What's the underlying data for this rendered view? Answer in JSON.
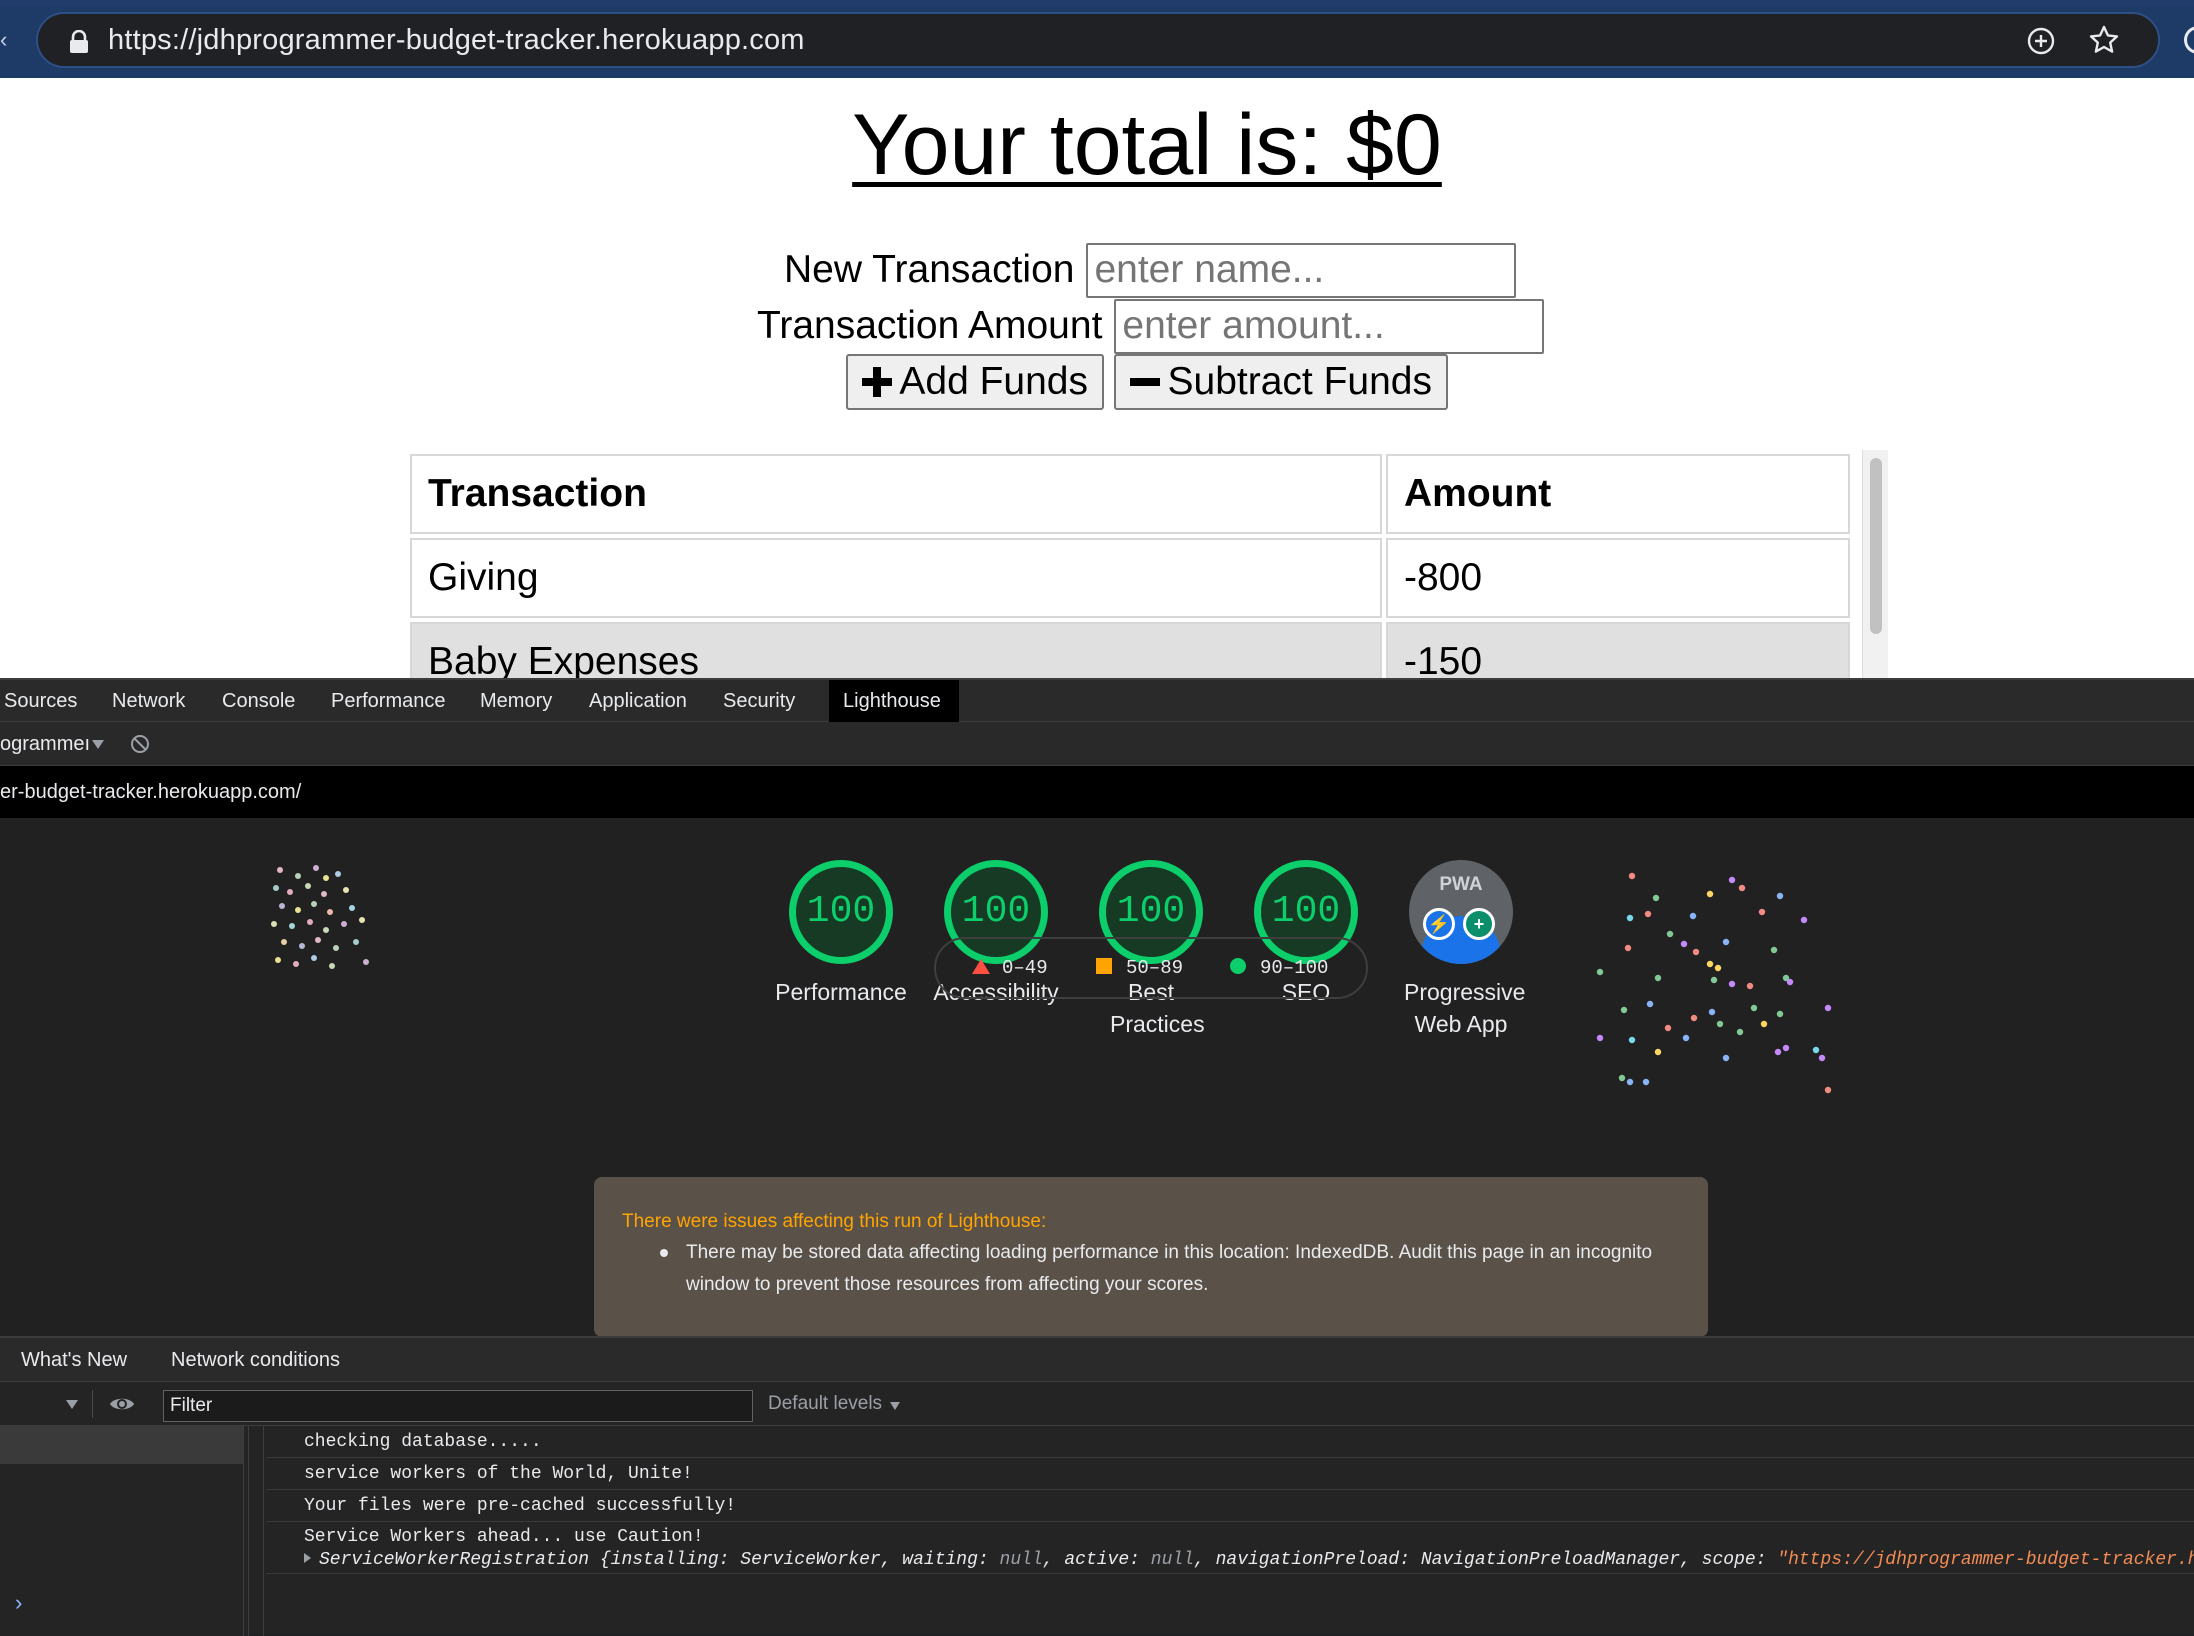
{
  "browser": {
    "url": "https://jdhprogrammer-budget-tracker.herokuapp.com"
  },
  "app": {
    "total_text": "Your total is: $0",
    "name_label": "New Transaction",
    "name_placeholder": "enter name...",
    "amount_label": "Transaction Amount",
    "amount_placeholder": "enter amount...",
    "add_button": "Add Funds",
    "subtract_button": "Subtract Funds",
    "table": {
      "headers": [
        "Transaction",
        "Amount"
      ],
      "rows": [
        {
          "name": "Giving",
          "amount": "-800"
        },
        {
          "name": "Baby Expenses",
          "amount": "-150"
        }
      ]
    }
  },
  "devtools": {
    "tabs": [
      "Sources",
      "Network",
      "Console",
      "Performance",
      "Memory",
      "Application",
      "Security",
      "Lighthouse"
    ],
    "active_tab": "Lighthouse",
    "report_selector": "ogrammeı",
    "report_url": "er-budget-tracker.herokuapp.com/",
    "scores": [
      {
        "value": "100",
        "label": "Performance"
      },
      {
        "value": "100",
        "label": "Accessibility"
      },
      {
        "value": "100",
        "label": "Best Practices"
      },
      {
        "value": "100",
        "label": "SEO"
      }
    ],
    "pwa": {
      "badge_text": "PWA",
      "label": "Progressive Web App"
    },
    "legend": [
      "0–49",
      "50–89",
      "90–100"
    ],
    "warning": {
      "title": "There were issues affecting this run of Lighthouse:",
      "message": "There may be stored data affecting loading performance in this location: IndexedDB. Audit this page in an incognito window to prevent those resources from affecting your scores."
    },
    "drawer": {
      "tabs": [
        "What's New",
        "Network conditions"
      ],
      "filter_placeholder": "Filter",
      "levels": "Default levels",
      "log": [
        "checking database.....",
        "service workers of the World, Unite!",
        "Your files were pre-cached successfully!",
        "Service Workers ahead... use Caution!"
      ],
      "object_line": {
        "prefix": "ServiceWorkerRegistration {installing: ServiceWorker, waiting: ",
        "null1": "null",
        "mid1": ", active: ",
        "null2": "null",
        "mid2": ", navigationPreload: NavigationPreloadManager, scope: ",
        "scope": "\"https://jdhprogrammer-budget-tracker.hero"
      }
    }
  },
  "colors": {
    "score_green": "#0cce6b",
    "warning_orange": "#ffa400",
    "fail_red": "#ff4e42"
  }
}
